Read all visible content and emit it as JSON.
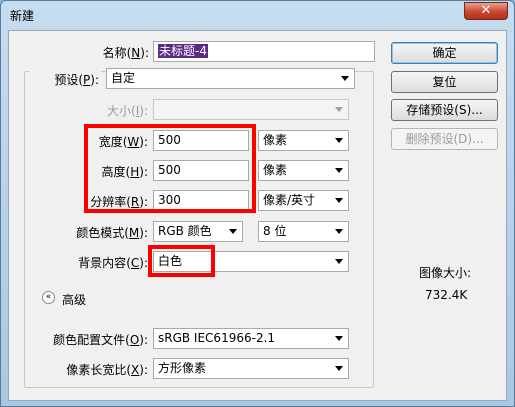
{
  "window": {
    "title": "新建",
    "close_glyph": "✕"
  },
  "name_field": {
    "label": "名称",
    "key": "N",
    "value": "未标题-4"
  },
  "preset": {
    "label": "预设",
    "key": "P",
    "value": "自定"
  },
  "size": {
    "label": "大小",
    "key": "I",
    "value": ""
  },
  "width": {
    "label": "宽度",
    "key": "W",
    "value": "500",
    "unit": "像素"
  },
  "height": {
    "label": "高度",
    "key": "H",
    "value": "500",
    "unit": "像素"
  },
  "resolution": {
    "label": "分辨率",
    "key": "R",
    "value": "300",
    "unit": "像素/英寸"
  },
  "color_mode": {
    "label": "颜色模式",
    "key": "M",
    "value": "RGB 颜色",
    "depth": "8 位"
  },
  "background": {
    "label": "背景内容",
    "key": "C",
    "value": "白色"
  },
  "advanced": {
    "label": "高级",
    "icon": "chevron-double-up-icon"
  },
  "color_profile": {
    "label": "颜色配置文件",
    "key": "O",
    "value": "sRGB IEC61966-2.1"
  },
  "pixel_aspect": {
    "label": "像素长宽比",
    "key": "X",
    "value": "方形像素"
  },
  "buttons": {
    "ok": "确定",
    "reset": "复位",
    "save_preset": "存储预设(S)...",
    "delete_preset": "删除预设(D)..."
  },
  "image_size": {
    "label": "图像大小:",
    "value": "732.4K"
  },
  "colors": {
    "annotation_red": "#ff0000",
    "selection_purple": "#5b2a86"
  }
}
